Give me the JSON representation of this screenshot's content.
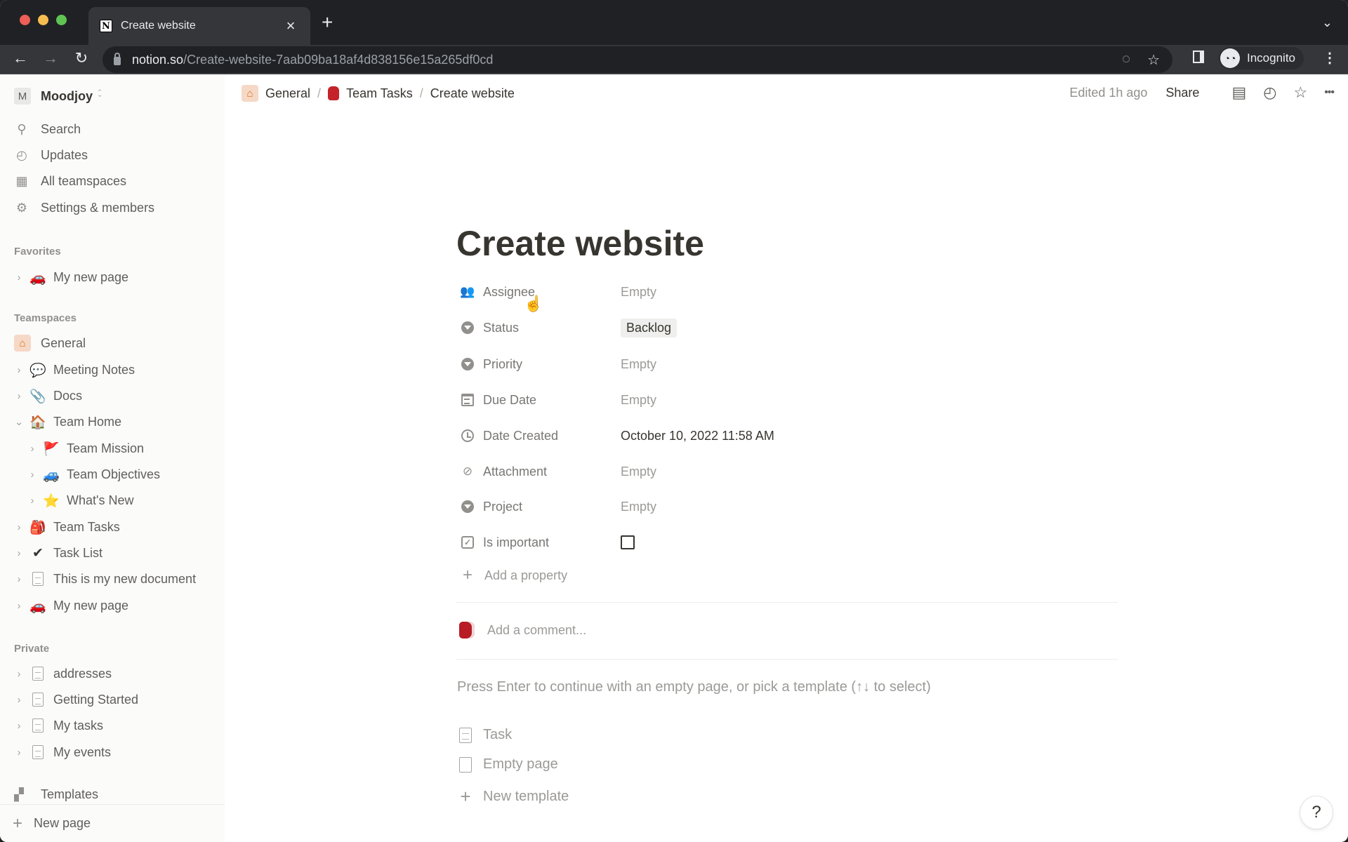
{
  "browser": {
    "tab_title": "Create website",
    "tab_favicon": "N",
    "url_host": "notion.so",
    "url_path": "/Create-website-7aab09ba18af4d838156e15a265df0cd",
    "profile_label": "Incognito",
    "icons": {
      "back": "←",
      "forward": "→",
      "reload": "↻",
      "close": "×",
      "new_tab": "+",
      "tab_menu": "⌄",
      "eye_off": "◌",
      "bookmark": "☆",
      "incognito": "◔◔",
      "menu": "⋮"
    }
  },
  "sidebar": {
    "workspace": {
      "initial": "M",
      "name": "Moodjoy"
    },
    "nav": [
      {
        "label": "Search",
        "icon": "⚲"
      },
      {
        "label": "Updates",
        "icon": "◴"
      },
      {
        "label": "All teamspaces",
        "icon": "▦"
      },
      {
        "label": "Settings & members",
        "icon": "⚙"
      }
    ],
    "favorites_heading": "Favorites",
    "favorites": [
      {
        "label": "My new page",
        "emoji": "🚗"
      }
    ],
    "teamspaces_heading": "Teamspaces",
    "teamspace": {
      "label": "General",
      "icon": "⌂"
    },
    "teamspace_pages": [
      {
        "label": "Meeting Notes",
        "emoji": "💬",
        "chevron": "›",
        "level": 0
      },
      {
        "label": "Docs",
        "emoji": "📎",
        "chevron": "›",
        "level": 0
      },
      {
        "label": "Team Home",
        "emoji": "🏠",
        "chevron": "⌄",
        "level": 0
      },
      {
        "label": "Team Mission",
        "emoji": "🚩",
        "chevron": "›",
        "level": 1
      },
      {
        "label": "Team Objectives",
        "emoji": "🚙",
        "chevron": "›",
        "level": 1
      },
      {
        "label": "What's New",
        "emoji": "⭐",
        "chevron": "›",
        "level": 1
      },
      {
        "label": "Team Tasks",
        "emoji": "🎒",
        "chevron": "›",
        "level": 0
      },
      {
        "label": "Task List",
        "emoji": "✔",
        "chevron": "›",
        "level": 0
      },
      {
        "label": "This is my new document",
        "emoji": "doc",
        "chevron": "›",
        "level": 0
      },
      {
        "label": "My new page",
        "emoji": "🚗",
        "chevron": "›",
        "level": 0
      }
    ],
    "private_heading": "Private",
    "private_pages": [
      {
        "label": "addresses"
      },
      {
        "label": "Getting Started"
      },
      {
        "label": "My tasks"
      },
      {
        "label": "My events"
      }
    ],
    "templates_label": "Templates",
    "new_page_label": "New page"
  },
  "topbar": {
    "breadcrumbs": [
      {
        "label": "General",
        "icon": "⌂"
      },
      {
        "label": "Team Tasks",
        "icon": "backpack"
      },
      {
        "label": "Create website"
      }
    ],
    "separator": "/",
    "edited": "Edited 1h ago",
    "share": "Share",
    "icons": {
      "comments": "▤",
      "history": "◴",
      "favorite": "☆",
      "more": "•••"
    }
  },
  "page": {
    "title": "Create website",
    "properties": [
      {
        "label": "Assignee",
        "value": "Empty",
        "icon": "people"
      },
      {
        "label": "Status",
        "value": "Backlog",
        "icon": "select"
      },
      {
        "label": "Priority",
        "value": "Empty",
        "icon": "select"
      },
      {
        "label": "Due Date",
        "value": "Empty",
        "icon": "calendar"
      },
      {
        "label": "Date Created",
        "value": "October 10, 2022 11:58 AM",
        "icon": "clock"
      },
      {
        "label": "Attachment",
        "value": "Empty",
        "icon": "paperclip"
      },
      {
        "label": "Project",
        "value": "Empty",
        "icon": "select"
      },
      {
        "label": "Is important",
        "checked": false,
        "icon": "checkbox"
      }
    ],
    "add_property": "Add a property",
    "comment_placeholder": "Add a comment...",
    "template_hint": "Press Enter to continue with an empty page, or pick a template (↑↓ to select)",
    "templates": [
      {
        "label": "Task"
      },
      {
        "label": "Empty page"
      },
      {
        "label": "New template"
      }
    ],
    "help": "?"
  }
}
